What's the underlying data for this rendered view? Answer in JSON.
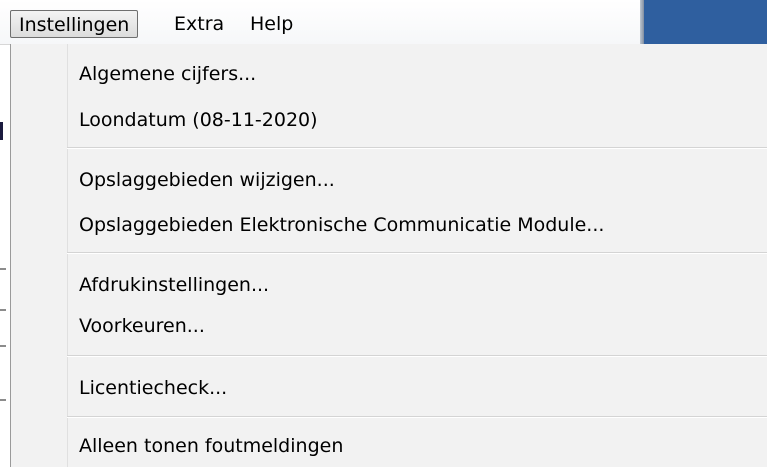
{
  "menubar": {
    "items": [
      {
        "label": "Instellingen"
      },
      {
        "label": "Extra"
      },
      {
        "label": "Help"
      }
    ]
  },
  "dropdown": {
    "items": [
      {
        "label": "Algemene cijfers..."
      },
      {
        "label": "Loondatum (08-11-2020)"
      },
      {
        "label": "Opslaggebieden wijzigen..."
      },
      {
        "label": "Opslaggebieden Elektronische Communicatie Module..."
      },
      {
        "label": "Afdrukinstellingen..."
      },
      {
        "label": "Voorkeuren..."
      },
      {
        "label": "Licentiecheck..."
      },
      {
        "label": "Alleen tonen foutmeldingen"
      }
    ]
  },
  "colors": {
    "background_window": "#2f5f9f",
    "menu_background": "#f2f2f2"
  }
}
